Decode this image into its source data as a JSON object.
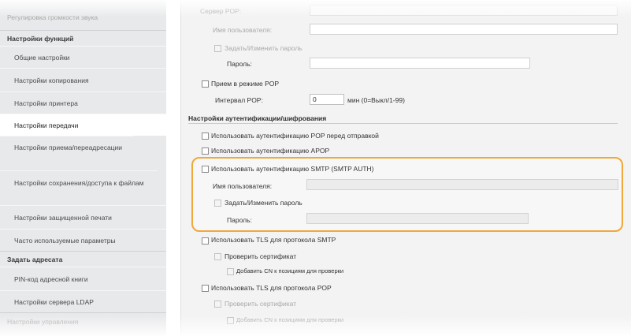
{
  "sidebar": {
    "top_item": "Регулировка громкости звука",
    "group_functions": "Настройки функций",
    "items_functions": [
      "Общие настройки",
      "Настройки копирования",
      "Настройки принтера",
      "Настройки передачи",
      "Настройки приема/переадресации",
      "Настройки сохранения/доступа к файлам",
      "Настройки защищенной печати",
      "Часто используемые параметры"
    ],
    "group_addressee": "Задать адресата",
    "items_addressee": [
      "PIN-код адресной книги",
      "Настройки сервера LDAP"
    ],
    "bottom_item": "Настройки управления"
  },
  "main": {
    "pop_server_label": "Сервер POP:",
    "pop_username_label": "Имя пользователя:",
    "pop_set_password_label": "Задать/Изменить пароль",
    "pop_password_label": "Пароль:",
    "pop_receive_label": "Прием в режиме POP",
    "pop_interval_label": "Интервал POP:",
    "pop_interval_value": "0",
    "pop_interval_unit": "мин (0=Выкл/1-99)",
    "auth_section_title": "Настройки аутентификации/шифрования",
    "auth_pop_before_send": "Использовать аутентификацию POP перед отправкой",
    "auth_apop": "Использовать аутентификацию APOP",
    "auth_smtp": "Использовать аутентификацию SMTP (SMTP AUTH)",
    "smtp_username_label": "Имя пользователя:",
    "smtp_set_password_label": "Задать/Изменить пароль",
    "smtp_password_label": "Пароль:",
    "tls_smtp": "Использовать TLS для протокола SMTP",
    "tls_smtp_verify": "Проверить сертификат",
    "tls_smtp_add_cn": "Добавить CN к позициям для проверки",
    "tls_pop": "Использовать TLS для протокола POP",
    "tls_pop_verify": "Проверить сертификат",
    "tls_pop_add_cn": "Добавить CN к позициям для проверки"
  },
  "colors": {
    "highlight": "#f0a83a",
    "sidebar_bg": "#e8e9eb",
    "main_bg": "#f3f3f3"
  }
}
